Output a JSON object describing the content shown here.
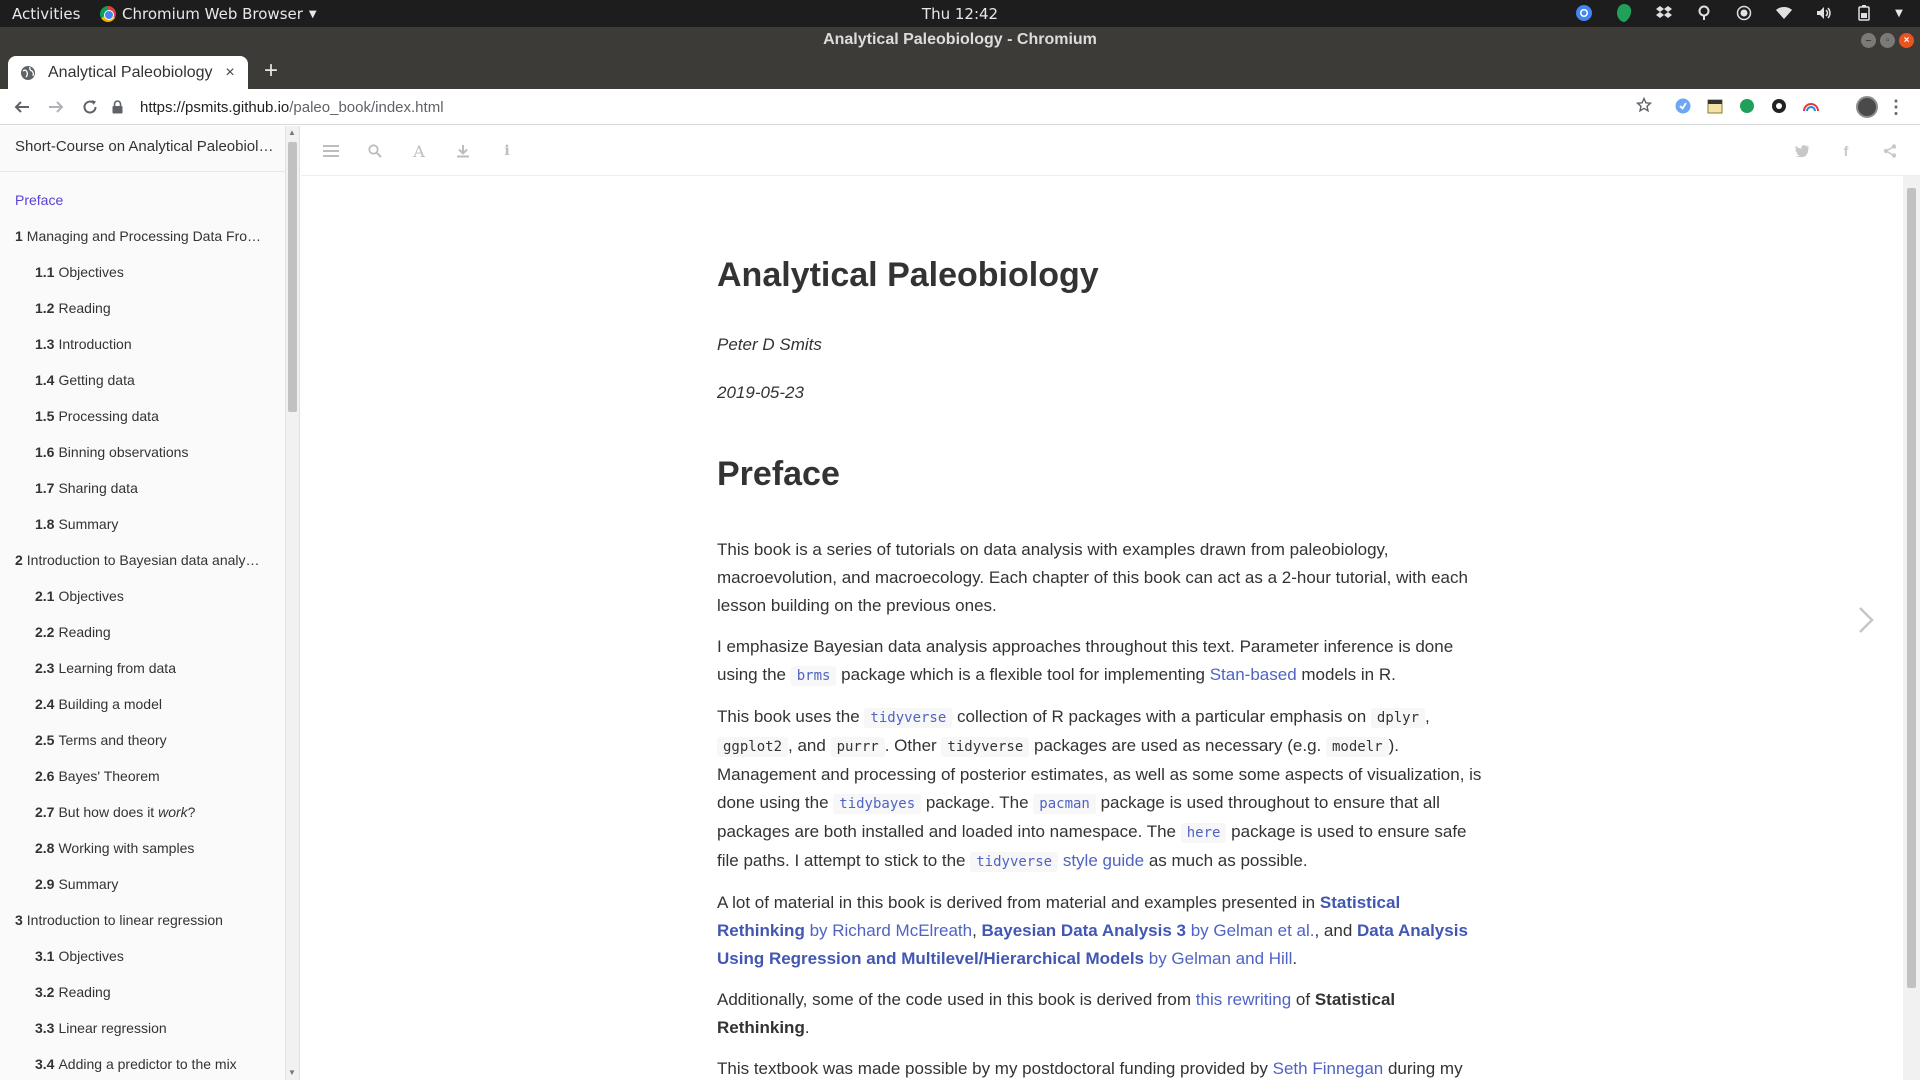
{
  "topbar": {
    "activities": "Activities",
    "app_menu": "Chromium Web Browser",
    "clock": "Thu 12:42"
  },
  "window": {
    "title": "Analytical Paleobiology - Chromium"
  },
  "tab": {
    "title": "Analytical Paleobiology",
    "close": "×",
    "new_tab": "+"
  },
  "address": {
    "host": "https://psmits.github.io",
    "path": "/paleo_book/index.html"
  },
  "sidebar": {
    "book_title": "Short-Course on Analytical Paleobiol…",
    "items": [
      {
        "num": "",
        "label": "Preface",
        "level": "ch",
        "state": "preface"
      },
      {
        "num": "1",
        "label": "Managing and Processing Data Fro…",
        "level": "ch"
      },
      {
        "num": "1.1",
        "label": "Objectives",
        "level": "sub"
      },
      {
        "num": "1.2",
        "label": "Reading",
        "level": "sub"
      },
      {
        "num": "1.3",
        "label": "Introduction",
        "level": "sub"
      },
      {
        "num": "1.4",
        "label": "Getting data",
        "level": "sub"
      },
      {
        "num": "1.5",
        "label": "Processing data",
        "level": "sub"
      },
      {
        "num": "1.6",
        "label": "Binning observations",
        "level": "sub"
      },
      {
        "num": "1.7",
        "label": "Sharing data",
        "level": "sub"
      },
      {
        "num": "1.8",
        "label": "Summary",
        "level": "sub"
      },
      {
        "num": "2",
        "label": "Introduction to Bayesian data analy…",
        "level": "ch"
      },
      {
        "num": "2.1",
        "label": "Objectives",
        "level": "sub"
      },
      {
        "num": "2.2",
        "label": "Reading",
        "level": "sub"
      },
      {
        "num": "2.3",
        "label": "Learning from data",
        "level": "sub"
      },
      {
        "num": "2.4",
        "label": "Building a model",
        "level": "sub"
      },
      {
        "num": "2.5",
        "label": "Terms and theory",
        "level": "sub"
      },
      {
        "num": "2.6",
        "label": "Bayes' Theorem",
        "level": "sub"
      },
      {
        "num": "2.7",
        "label": "But how does it work?",
        "level": "sub"
      },
      {
        "num": "2.8",
        "label": "Working with samples",
        "level": "sub"
      },
      {
        "num": "2.9",
        "label": "Summary",
        "level": "sub"
      },
      {
        "num": "3",
        "label": "Introduction to linear regression",
        "level": "ch"
      },
      {
        "num": "3.1",
        "label": "Objectives",
        "level": "sub"
      },
      {
        "num": "3.2",
        "label": "Reading",
        "level": "sub"
      },
      {
        "num": "3.3",
        "label": "Linear regression",
        "level": "sub"
      },
      {
        "num": "3.4",
        "label": "Adding a predictor to the mix",
        "level": "sub"
      }
    ]
  },
  "book": {
    "title": "Analytical Paleobiology",
    "author": "Peter D Smits",
    "date": "2019-05-23",
    "section_title": "Preface",
    "p1": "This book is a series of tutorials on data analysis with examples drawn from paleobiology, macroevolution, and macroecology. Each chapter of this book can act as a 2-hour tutorial, with each lesson building on the previous ones.",
    "p2": {
      "t1": "I emphasize Bayesian data analysis approaches throughout this text. Parameter inference is done using the ",
      "code_brms": "brms",
      "t2": " package which is a flexible tool for implementing ",
      "link_stan": "Stan-based",
      "t3": " models in R."
    },
    "p3": {
      "t1": "This book uses the ",
      "code_tidyverse": "tidyverse",
      "t2": " collection of R packages with a particular emphasis on ",
      "code_dplyr": "dplyr",
      "t3": ", ",
      "code_ggplot2": "ggplot2",
      "t4": ", and ",
      "code_purrr": "purrr",
      "t5": ". Other ",
      "code_tidyverse2": "tidyverse",
      "t6": " packages are used as necessary (e.g. ",
      "code_modelr": "modelr",
      "t7": "). Management and processing of posterior estimates, as well as some some aspects of visualization, is done using the ",
      "code_tidybayes": "tidybayes",
      "t8": " package. The ",
      "code_pacman": "pacman",
      "t9": " package is used throughout to ensure that all packages are both installed and loaded into namespace. The ",
      "code_here": "here",
      "t10": " package is used to ensure safe file paths. I attempt to stick to the ",
      "code_tidyverse3": "tidyverse",
      "link_style": " style guide",
      "t11": " as much as possible."
    },
    "p4": {
      "t1": "A lot of material in this book is derived from material and examples presented in ",
      "b1": "Statistical Rethinking",
      "a1": " by Richard McElreath",
      "t2": ", ",
      "b2": "Bayesian Data Analysis 3",
      "a2": " by Gelman et al.",
      "t3": ", and ",
      "b3": "Data Analysis Using Regression and Multilevel/Hierarchical Models",
      "a3": " by Gelman and Hill",
      "t4": "."
    },
    "p5": {
      "t1": "Additionally, some of the code used in this book is derived from ",
      "link": "this rewriting",
      "t2": " of ",
      "bold": "Statistical Rethinking",
      "t3": "."
    },
    "p6": {
      "t1": "This textbook was made possible by my postdoctoral funding provided by ",
      "link": "Seth Finnegan",
      "t2": " during my"
    }
  },
  "colors": {
    "link": "#4f63c4",
    "preface": "#5b3fd6",
    "topbar": "#1d1d1d",
    "titlebar": "#3c3b37",
    "close_button": "#e95420"
  },
  "icons": {
    "toolbar_left": [
      "hamburger-icon",
      "search-icon",
      "font-settings-icon",
      "download-icon",
      "info-icon"
    ],
    "toolbar_right": [
      "twitter-icon",
      "facebook-icon",
      "share-icon"
    ],
    "navigation": "chevron-right-icon"
  }
}
